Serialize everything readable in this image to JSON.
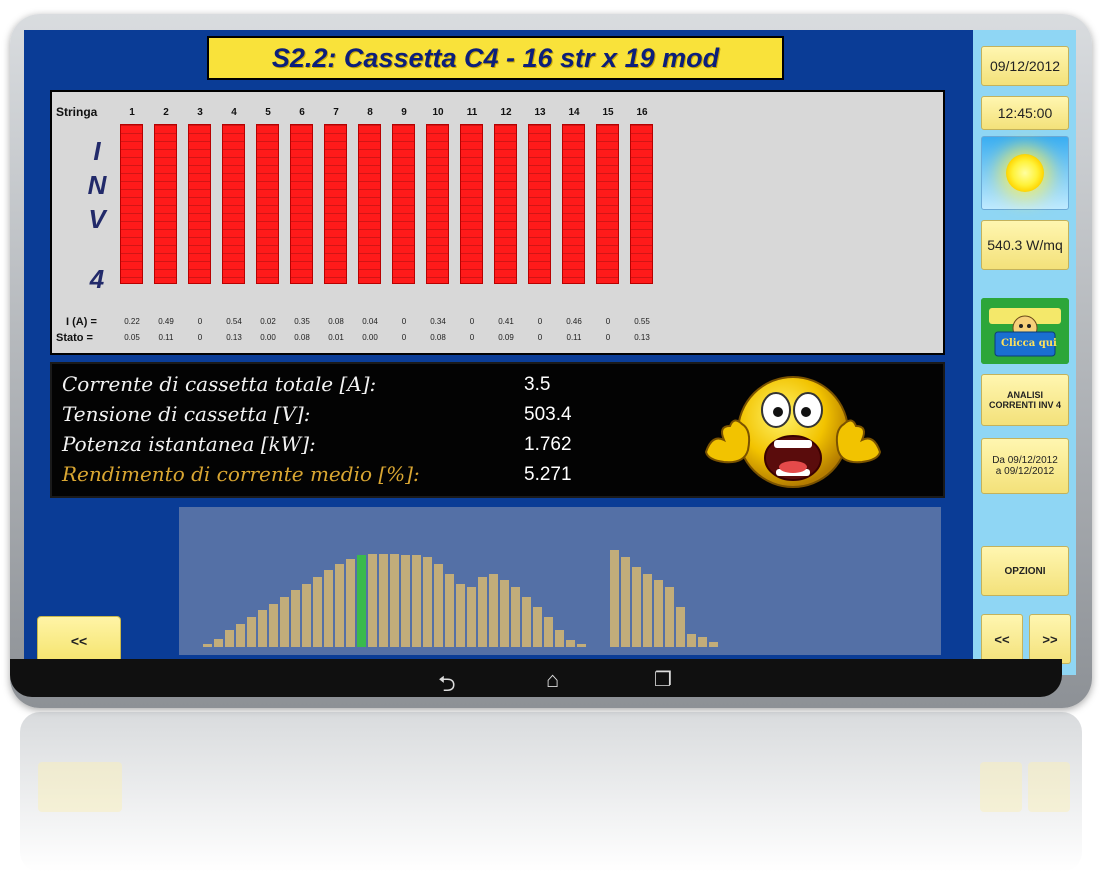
{
  "header": {
    "title": "S2.2: Cassetta C4 - 16 str x 19 mod"
  },
  "strings": {
    "stringa_label": "Stringa",
    "inv_letters": [
      "I",
      "N",
      "V"
    ],
    "inv_number": "4",
    "current_label": "I (A) =",
    "status_label": "Stato =",
    "numbers": [
      "1",
      "2",
      "3",
      "4",
      "5",
      "6",
      "7",
      "8",
      "9",
      "10",
      "11",
      "12",
      "13",
      "14",
      "15",
      "16"
    ],
    "currents": [
      "0.22",
      "0.49",
      "0",
      "0.54",
      "0.02",
      "0.35",
      "0.08",
      "0.04",
      "0",
      "0.34",
      "0",
      "0.41",
      "0",
      "0.46",
      "0",
      "0.55"
    ],
    "states": [
      "0.05",
      "0.11",
      "0",
      "0.13",
      "0.00",
      "0.08",
      "0.01",
      "0.00",
      "0",
      "0.08",
      "0",
      "0.09",
      "0",
      "0.11",
      "0",
      "0.13"
    ],
    "bar_color": "#ff1a1a"
  },
  "info": {
    "rows": [
      {
        "label": "Corrente di cassetta totale [A]:",
        "value": "3.5"
      },
      {
        "label": "Tensione di cassetta [V]:",
        "value": "503.4"
      },
      {
        "label": "Potenza istantanea [kW]:",
        "value": "1.762"
      },
      {
        "label": "Rendimento di corrente medio [%]:",
        "value": "5.271"
      }
    ],
    "emoji": "screaming-face"
  },
  "histogram": {
    "values": [
      2,
      5,
      10,
      14,
      18,
      22,
      26,
      30,
      34,
      38,
      42,
      46,
      50,
      53,
      55,
      56,
      56,
      56,
      55,
      55,
      54,
      50,
      44,
      38,
      36,
      42,
      44,
      40,
      36,
      30,
      24,
      18,
      10,
      4,
      2,
      0,
      0,
      58,
      54,
      48,
      44,
      40,
      36,
      24,
      8,
      6,
      3
    ],
    "highlight_index": 14,
    "max": 60,
    "colors": {
      "bar": "#c2ad7a",
      "highlight": "#3aba4c",
      "background": "#5470a6"
    }
  },
  "sidebar": {
    "date": "09/12/2012",
    "time": "12:45:00",
    "weather_icon": "sun-icon",
    "irradiance": "540.3 W/mq",
    "report_label": "Clicca qui",
    "analysis_button": "ANALISI CORRENTI INV 4",
    "range_button": "Da 09/12/2012 a 09/12/2012",
    "options_button": "OPZIONI",
    "prev_button": "<<",
    "next_button": ">>"
  },
  "main": {
    "back_button": "<<"
  },
  "navbar": {
    "icons": [
      "back-icon",
      "home-icon",
      "recent-apps-icon"
    ]
  }
}
